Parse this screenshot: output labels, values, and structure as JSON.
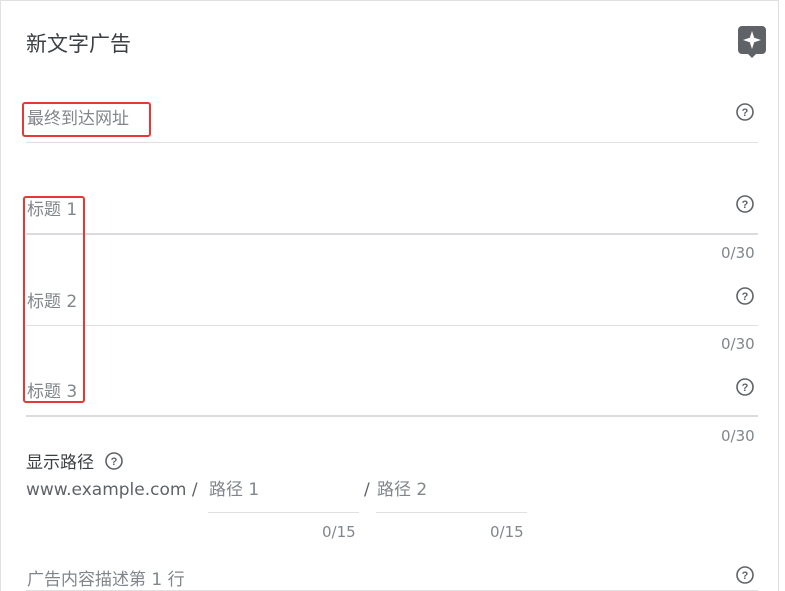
{
  "header": {
    "title": "新文字广告",
    "icon": "sparkle-icon"
  },
  "fields": {
    "final_url": {
      "label": "最终到达网址"
    },
    "headline1": {
      "label": "标题 1",
      "counter": "0/30"
    },
    "headline2": {
      "label": "标题 2",
      "counter": "0/30"
    },
    "headline3": {
      "label": "标题 3",
      "counter": "0/30"
    },
    "description1": {
      "label": "广告内容描述第 1 行"
    }
  },
  "display_path": {
    "label": "显示路径",
    "domain": "www.example.com /",
    "path1": {
      "placeholder": "路径 1",
      "counter": "0/15"
    },
    "separator": "/",
    "path2": {
      "placeholder": "路径 2",
      "counter": "0/15"
    }
  },
  "colors": {
    "highlight_border": "#e53935",
    "divider": "#e0e0e0",
    "icon_gray": "#5f6368"
  }
}
